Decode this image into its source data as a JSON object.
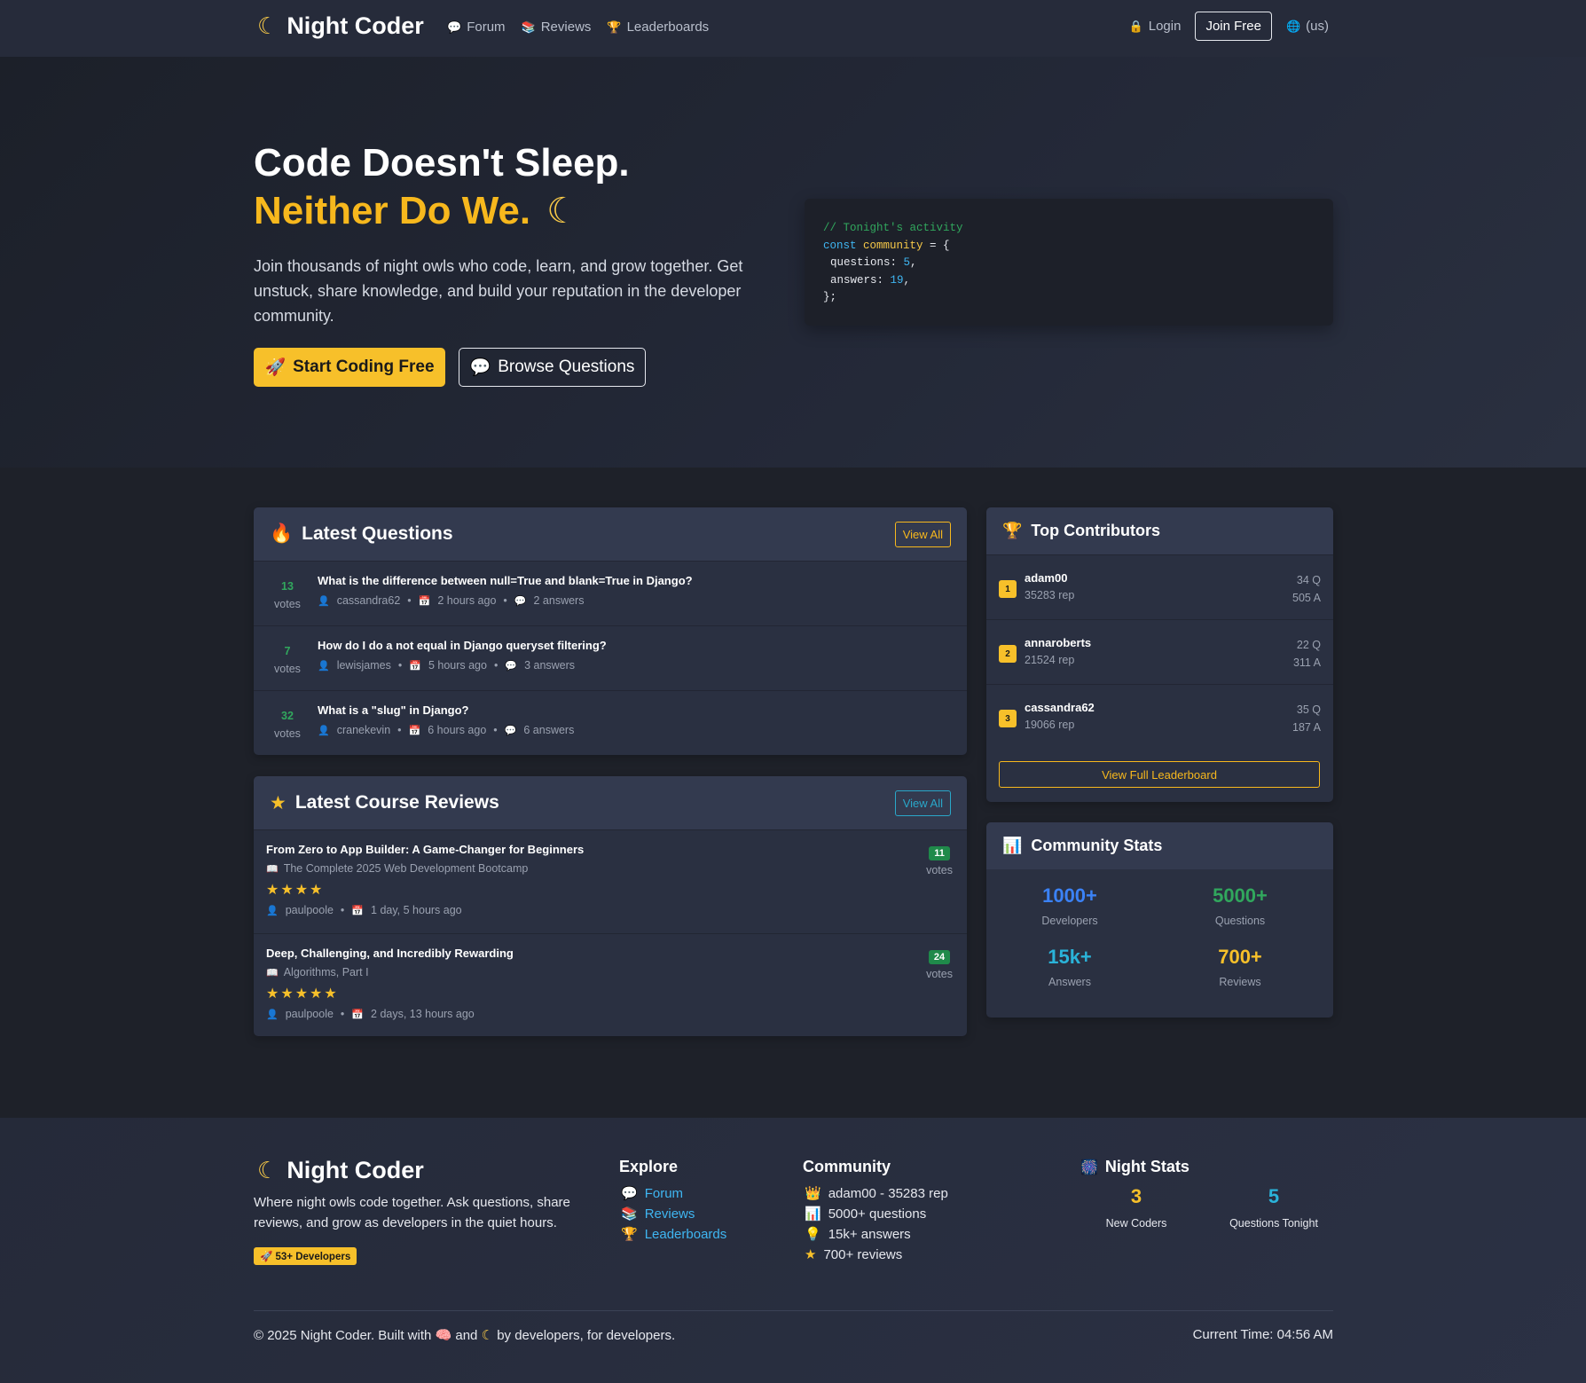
{
  "nav": {
    "brand": "Night Coder",
    "links": [
      "Forum",
      "Reviews",
      "Leaderboards"
    ],
    "login": "Login",
    "join": "Join Free",
    "locale": "(us)"
  },
  "hero": {
    "title1": "Code Doesn't Sleep.",
    "title2": "Neither Do We.",
    "lead": "Join thousands of night owls who code, learn, and grow together. Get unstuck, share knowledge, and build your reputation in the developer community.",
    "cta_primary": "Start Coding Free",
    "cta_secondary": "Browse Questions",
    "code": {
      "comment": "// Tonight's activity",
      "kw": "const",
      "var": "community",
      "eq": " = {",
      "q_label": "questions: ",
      "q_val": "5",
      "a_label": "answers: ",
      "a_val": "19",
      "close": "};"
    }
  },
  "questions": {
    "title": "Latest Questions",
    "view_all": "View All",
    "items": [
      {
        "votes": "13",
        "votes_label": "votes",
        "title": "What is the difference between null=True and blank=True in Django?",
        "user": "cassandra62",
        "time": "2 hours ago",
        "answers": "2 answers"
      },
      {
        "votes": "7",
        "votes_label": "votes",
        "title": "How do I do a not equal in Django queryset filtering?",
        "user": "lewisjames",
        "time": "5 hours ago",
        "answers": "3 answers"
      },
      {
        "votes": "32",
        "votes_label": "votes",
        "title": "What is a \"slug\" in Django?",
        "user": "cranekevin",
        "time": "6 hours ago",
        "answers": "6 answers"
      }
    ]
  },
  "reviews": {
    "title": "Latest Course Reviews",
    "view_all": "View All",
    "items": [
      {
        "title": "From Zero to App Builder: A Game-Changer for Beginners",
        "course": "The Complete 2025 Web Development Bootcamp",
        "stars": "★★★★",
        "user": "paulpoole",
        "time": "1 day, 5 hours ago",
        "votes": "11",
        "votes_label": "votes"
      },
      {
        "title": "Deep, Challenging, and Incredibly Rewarding",
        "course": "Algorithms, Part I",
        "stars": "★★★★★",
        "user": "paulpoole",
        "time": "2 days, 13 hours ago",
        "votes": "24",
        "votes_label": "votes"
      }
    ]
  },
  "contributors": {
    "title": "Top Contributors",
    "items": [
      {
        "rank": "1",
        "name": "adam00",
        "rep": "35283 rep",
        "q": "34 Q",
        "a": "505 A"
      },
      {
        "rank": "2",
        "name": "annaroberts",
        "rep": "21524 rep",
        "q": "22 Q",
        "a": "311 A"
      },
      {
        "rank": "3",
        "name": "cassandra62",
        "rep": "19066 rep",
        "q": "35 Q",
        "a": "187 A"
      }
    ],
    "view_full": "View Full Leaderboard"
  },
  "stats": {
    "title": "Community Stats",
    "items": [
      {
        "value": "1000+",
        "label": "Developers",
        "color": "#3b82f6"
      },
      {
        "value": "5000+",
        "label": "Questions",
        "color": "#31a75d"
      },
      {
        "value": "15k+",
        "label": "Answers",
        "color": "#2ab3d9"
      },
      {
        "value": "700+",
        "label": "Reviews",
        "color": "#f7c02a"
      }
    ]
  },
  "footer": {
    "brand": "Night Coder",
    "desc": "Where night owls code together. Ask questions, share reviews, and grow as developers in the quiet hours.",
    "badge": "53+ Developers",
    "explore": {
      "title": "Explore",
      "links": [
        "Forum",
        "Reviews",
        "Leaderboards"
      ]
    },
    "community": {
      "title": "Community",
      "items": [
        "adam00 - 35283 rep",
        "5000+ questions",
        "15k+ answers",
        "700+ reviews"
      ]
    },
    "night": {
      "title": "Night Stats",
      "new_coders": "3",
      "new_coders_label": "New Coders",
      "questions": "5",
      "questions_label": "Questions Tonight"
    },
    "copy_a": "© 2025 Night Coder. Built with",
    "copy_b": "and",
    "copy_c": "by developers, for developers.",
    "time": "Current Time: 04:56 AM"
  }
}
